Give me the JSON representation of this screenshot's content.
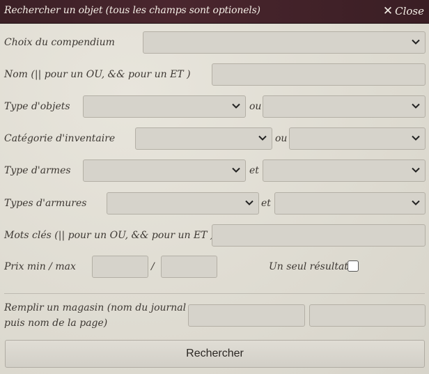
{
  "dialog": {
    "title": "Rechercher un objet (tous les champs sont optionels)",
    "close_label": "Close"
  },
  "form": {
    "compendium_label": "Choix du compendium",
    "name_label": "Nom (|| pour un OU, && pour un ET )",
    "object_type_label": "Type d'objets",
    "inventory_category_label": "Catégorie d'inventaire",
    "weapon_type_label": "Type d'armes",
    "armor_type_label": "Types d'armures",
    "keywords_label": "Mots clés (|| pour un OU, && pour un ET )",
    "price_label": "Prix min / max",
    "price_separator": "/",
    "or_label": "ou",
    "and_label": "et",
    "single_result_label": "Un seul résultat",
    "single_result_checked": false,
    "shop_label_line1": "Remplir un magasin (nom du journal",
    "shop_label_line2": "puis nom de la page)",
    "search_button": "Rechercher"
  },
  "colors": {
    "titlebar": "#3b2026",
    "background": "#e2dfd6",
    "field": "#d6d3cb",
    "field_border": "#b3afa5"
  }
}
